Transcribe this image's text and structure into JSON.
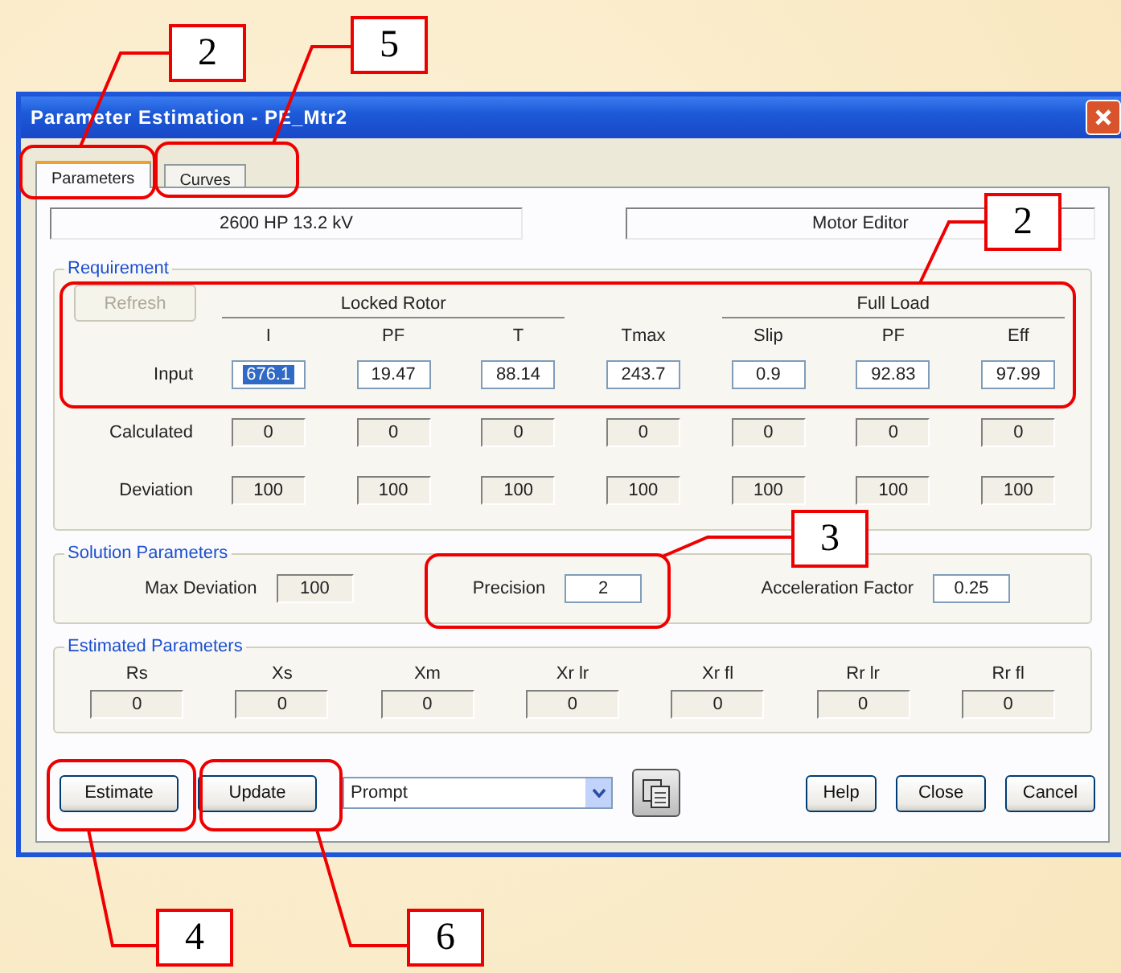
{
  "window": {
    "title": "Parameter Estimation - PE_Mtr2"
  },
  "tabs": [
    {
      "label": "Parameters",
      "selected": true
    },
    {
      "label": "Curves",
      "selected": false
    }
  ],
  "info": [
    "2600 HP   13.2 kV",
    "Motor Editor"
  ],
  "requirement": {
    "title": "Requirement",
    "refresh": {
      "label": "Refresh",
      "disabled": true
    },
    "groups": [
      {
        "label": "Locked Rotor",
        "columns": [
          "I",
          "PF",
          "T"
        ]
      },
      {
        "columns": [
          "Tmax"
        ]
      },
      {
        "label": "Full Load",
        "columns": [
          "Slip",
          "PF",
          "Eff"
        ]
      }
    ],
    "rows": [
      {
        "label": "Input",
        "kind": "input",
        "cells": [
          {
            "text": "676.1",
            "highlighted": true
          },
          {
            "text": "19.47",
            "highlighted": false
          },
          {
            "text": "88.14",
            "highlighted": false
          },
          {
            "text": "243.7",
            "highlighted": false
          },
          {
            "text": "0.9",
            "highlighted": false
          },
          {
            "text": "92.83",
            "highlighted": false
          },
          {
            "text": "97.99",
            "highlighted": false
          }
        ]
      },
      {
        "label": "Calculated",
        "kind": "readout",
        "cells": [
          {
            "text": "0"
          },
          {
            "text": "0"
          },
          {
            "text": "0"
          },
          {
            "text": "0"
          },
          {
            "text": "0"
          },
          {
            "text": "0"
          },
          {
            "text": "0"
          }
        ]
      },
      {
        "label": "Deviation",
        "kind": "readout",
        "cells": [
          {
            "text": "100"
          },
          {
            "text": "100"
          },
          {
            "text": "100"
          },
          {
            "text": "100"
          },
          {
            "text": "100"
          },
          {
            "text": "100"
          },
          {
            "text": "100"
          }
        ]
      }
    ]
  },
  "solution": {
    "title": "Solution Parameters",
    "fields": [
      {
        "label": "Max Deviation",
        "value": "100",
        "kind": "readout"
      },
      {
        "label": "Precision",
        "value": "2",
        "kind": "input"
      },
      {
        "label": "Acceleration Factor",
        "value": "0.25",
        "kind": "input"
      }
    ]
  },
  "estimated": {
    "title": "Estimated Parameters",
    "columns": [
      {
        "label": "Rs",
        "value": "0"
      },
      {
        "label": "Xs",
        "value": "0"
      },
      {
        "label": "Xm",
        "value": "0"
      },
      {
        "label": "Xr lr",
        "value": "0"
      },
      {
        "label": "Xr fl",
        "value": "0"
      },
      {
        "label": "Rr lr",
        "value": "0"
      },
      {
        "label": "Rr fl",
        "value": "0"
      }
    ]
  },
  "buttons_left": [
    "Estimate",
    "Update"
  ],
  "dropdown": {
    "value": "Prompt"
  },
  "buttons_right": [
    "Help",
    "Close",
    "Cancel"
  ],
  "callouts": [
    {
      "number": "2"
    },
    {
      "number": "5"
    },
    {
      "number": "2"
    },
    {
      "number": "3"
    },
    {
      "number": "4"
    },
    {
      "number": "6"
    }
  ]
}
